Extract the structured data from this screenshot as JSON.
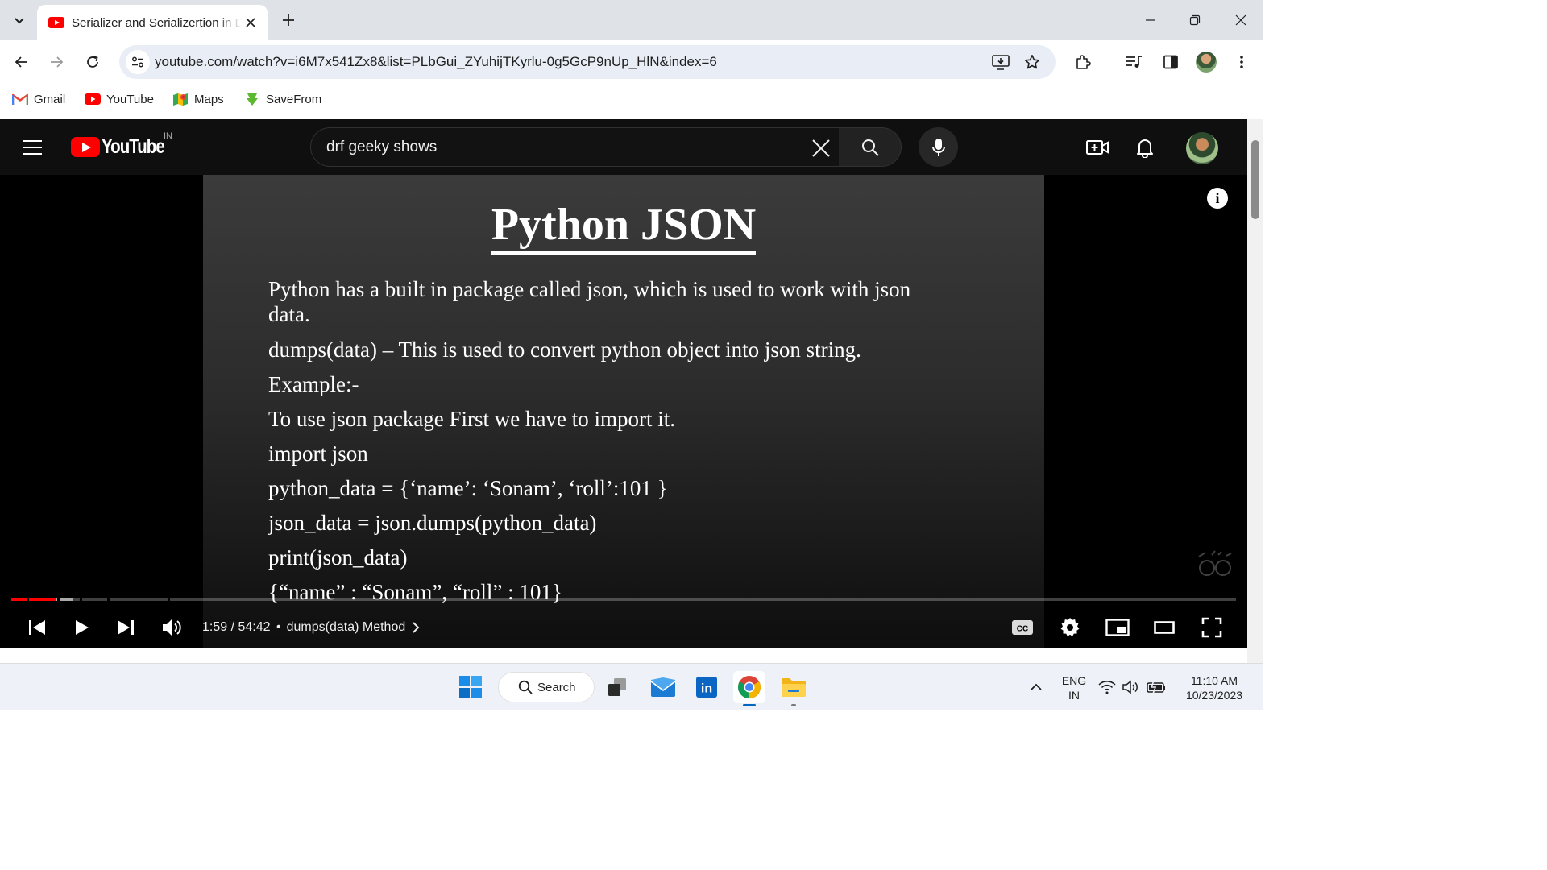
{
  "browser": {
    "tab_title": "Serializer and Serializertion in D",
    "url": "youtube.com/watch?v=i6M7x541Zx8&list=PLbGui_ZYuhijTKyrlu-0g5GcP9nUp_HlN&index=6",
    "bookmarks": [
      {
        "label": "Gmail",
        "icon": "gmail-icon"
      },
      {
        "label": "YouTube",
        "icon": "youtube-icon"
      },
      {
        "label": "Maps",
        "icon": "maps-icon"
      },
      {
        "label": "SaveFrom",
        "icon": "savefrom-icon"
      }
    ]
  },
  "youtube": {
    "logo_text": "YouTube",
    "country_code": "IN",
    "search_query": "drf geeky shows"
  },
  "video": {
    "slide_title": "Python JSON",
    "slide_lines": [
      "Python has a built in package called json, which is used to work with json",
      "data.",
      "dumps(data) – This is used to convert python object into json string.",
      "Example:-",
      "To use json package First we have to import it.",
      "import json",
      "python_data = {‘name’: ‘Sonam’, ‘roll’:101 }",
      "json_data = json.dumps(python_data)",
      "print(json_data)",
      "{“name” : “Sonam”, “roll” : 101}"
    ],
    "time": "1:59 / 54:42",
    "separator": "•",
    "chapter": "dumps(data) Method",
    "progress_fraction": 0.036,
    "buffered_fraction": 0.05
  },
  "taskbar": {
    "search_label": "Search",
    "lang_line1": "ENG",
    "lang_line2": "IN",
    "clock_time": "11:10 AM",
    "clock_date": "10/23/2023"
  },
  "colors": {
    "youtube_red": "#ff0000",
    "player_bg": "#000000",
    "masthead_bg": "#0f0f0f",
    "taskbar_bg": "#eef1f7"
  }
}
